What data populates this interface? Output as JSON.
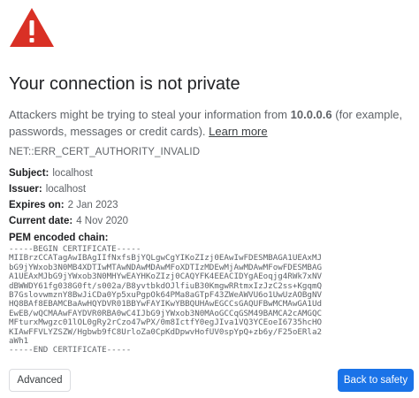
{
  "heading": "Your connection is not private",
  "description": {
    "before": "Attackers might be trying to steal your information from ",
    "host": "10.0.0.6",
    "after": " (for example, passwords, messages or credit cards). ",
    "learn_more": "Learn more"
  },
  "error_code": "NET::ERR_CERT_AUTHORITY_INVALID",
  "details": {
    "subject_label": "Subject:",
    "subject_value": "localhost",
    "issuer_label": "Issuer:",
    "issuer_value": "localhost",
    "expires_label": "Expires on:",
    "expires_value": "2 Jan 2023",
    "current_label": "Current date:",
    "current_value": "4 Nov 2020",
    "pem_label": "PEM encoded chain:"
  },
  "pem": "-----BEGIN CERTIFICATE-----\nMIIBrzCCATagAwIBAgIIfNxfsBjYQLgwCgYIKoZIzj0EAwIwFDESMBAGA1UEAxMJ\nbG9jYWxob3N0MB4XDTIwMTAwNDAwMDAwMFoXDTIzMDEwMjAwMDAwMFowFDESMBAG\nA1UEAxMJbG9jYWxob3N0MHYwEAYHKoZIzj0CAQYFK4EEACIDYgAEoqjg4RWk7xNV\ndBWWDY61fg038G0ft/s002a/B8yvtbkdOJlfiuB30KmgwRRtmxIzJzC2ss+KgqmQ\nB7GslovwmznY8BwJiCDa0Yp5xuPgpOk64PMa8aGTpF43ZWeAWVU6o1UwUzAOBgNV\nHQ8BAf8EBAMCBaAwHQYDVR01BBYwFAYIKwYBBQUHAwEGCCsGAQUFBwMCMAwGA1Ud\nEwEB/wQCMAAwFAYDVR0RBA0wC4IJbG9jYWxob3N0MAoGCCqGSM49BAMCA2cAMGQC\nMFturxMwgzc01lOL0gRy2rCzo47wPX/0m8IctfY0egJIva1VQ3YCEoeI6735hcHO\nKIAwFFVLYZSZW/Hgbwb9fC8UrloZa0CpKdDpwvHofUV0spYpQ+zb6y/F25oERla2\naWh1\n-----END CERTIFICATE-----",
  "buttons": {
    "advanced": "Advanced",
    "back_to_safety": "Back to safety"
  },
  "colors": {
    "warning_icon": "#d93025",
    "primary_button": "#1a73e8",
    "link": "#3c4043"
  },
  "icons": {
    "warning": "warning-triangle-icon"
  }
}
